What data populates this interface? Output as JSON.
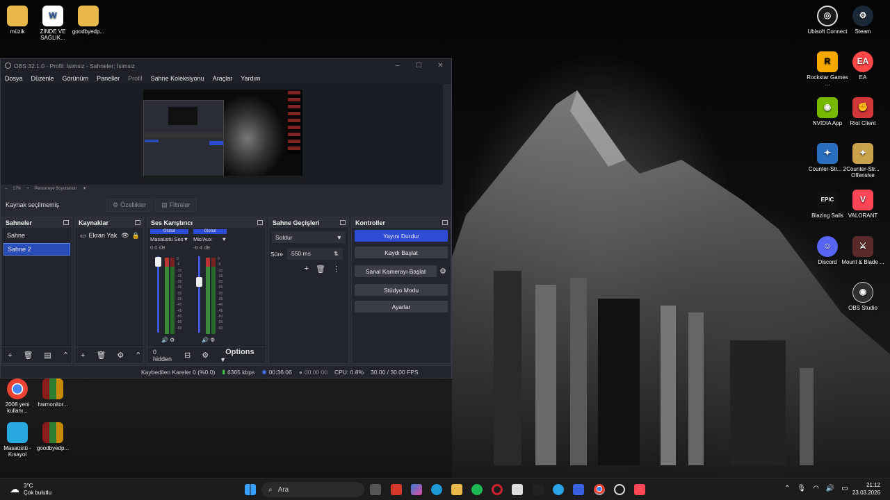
{
  "obs": {
    "title": "OBS 32.1.0 - Profil: İsimsiz - Sahneler: İsimsiz",
    "menu": [
      "Dosya",
      "Düzenle",
      "Görünüm",
      "Paneller",
      "Profil",
      "Sahne Koleksiyonu",
      "Araçlar",
      "Yardım"
    ],
    "zoom": "17%",
    "fit_label": "Pencereye Boyutlandır",
    "no_source": "Kaynak seçilmemiş",
    "properties_btn": "Özellikler",
    "filters_btn": "Filtreler",
    "docks": {
      "scenes": {
        "title": "Sahneler",
        "items": [
          "Sahne",
          "Sahne 2"
        ],
        "selected": 1
      },
      "sources": {
        "title": "Kaynaklar",
        "items": [
          "Ekran Yak"
        ]
      },
      "mixer": {
        "title": "Ses Karıştırıcı",
        "channels": [
          {
            "badge": "Global",
            "name": "Masaüstü Ses",
            "level": "0.0 dB"
          },
          {
            "badge": "Global",
            "name": "Mic/Aux",
            "level": "-8.4 dB"
          }
        ],
        "scale": [
          "0",
          "-5",
          "-10",
          "-15",
          "-20",
          "-25",
          "-30",
          "-35",
          "-40",
          "-45",
          "-50",
          "-55",
          "-60"
        ],
        "hidden_label": "0 hidden",
        "options_label": "Options"
      },
      "transitions": {
        "title": "Sahne Geçişleri",
        "type": "Soldur",
        "duration_label": "Süre",
        "duration": "550 ms"
      },
      "controls": {
        "title": "Kontroller",
        "buttons": [
          "Yayını Durdur",
          "Kaydı Başlat",
          "Sanal Kamerayı Başlat",
          "Stüdyo Modu",
          "Ayarlar"
        ]
      }
    },
    "status": {
      "dropped": "Kaybedilen Kareler 0 (%0.0)",
      "bitrate": "6365 kbps",
      "stream_time": "00:36:06",
      "rec_time": "00:00:00",
      "cpu": "CPU: 0.8%",
      "fps": "30.00 / 30.00 FPS"
    }
  },
  "desktop_left": [
    {
      "label": "müzik",
      "icon": "folder-icon"
    },
    {
      "label": "ZİNDE VE SAĞLIK...",
      "icon": "word-doc-icon"
    },
    {
      "label": "goodbyedp...",
      "icon": "folder-icon"
    },
    {
      "label": "2008 yeni kullanı...",
      "icon": "chrome-icon"
    },
    {
      "label": "hwmonitor...",
      "icon": "archive-icon"
    },
    {
      "label": "Masaüstü - Kısayol",
      "icon": "desktop-shortcut-icon"
    },
    {
      "label": "goodbyedp...",
      "icon": "archive-icon"
    }
  ],
  "desktop_right": [
    {
      "label": "Ubisoft Connect",
      "icon": "ubisoft-icon",
      "color": "#1a1a1a"
    },
    {
      "label": "Steam",
      "icon": "steam-icon",
      "color": "#1b2838"
    },
    {
      "label": "Rockstar Games ...",
      "icon": "rockstar-icon",
      "color": "#f6a800"
    },
    {
      "label": "EA",
      "icon": "ea-icon",
      "color": "#ff4747"
    },
    {
      "label": "NVIDIA App",
      "icon": "nvidia-icon",
      "color": "#76b900"
    },
    {
      "label": "Riot Client",
      "icon": "riot-icon",
      "color": "#d13639"
    },
    {
      "label": "Counter-Str... 2",
      "icon": "cs2-icon",
      "color": "#2a6fbf"
    },
    {
      "label": "Counter-Str... Offensive",
      "icon": "csgo-icon",
      "color": "#caa24b"
    },
    {
      "label": "Blazing Sails",
      "icon": "epic-icon",
      "color": "#111111"
    },
    {
      "label": "VALORANT",
      "icon": "valorant-icon",
      "color": "#fd4556"
    },
    {
      "label": "Discord",
      "icon": "discord-icon",
      "color": "#5865f2"
    },
    {
      "label": "Mount & Blade ...",
      "icon": "mount-blade-icon",
      "color": "#5a2a2a"
    },
    {
      "label": "OBS Studio",
      "icon": "obs-icon",
      "color": "#302e31"
    }
  ],
  "taskbar": {
    "search_label": "Ara",
    "weather_temp": "3°C",
    "weather_desc": "Çok bulutlu",
    "time": "21:12",
    "date": "23.03.2026"
  }
}
